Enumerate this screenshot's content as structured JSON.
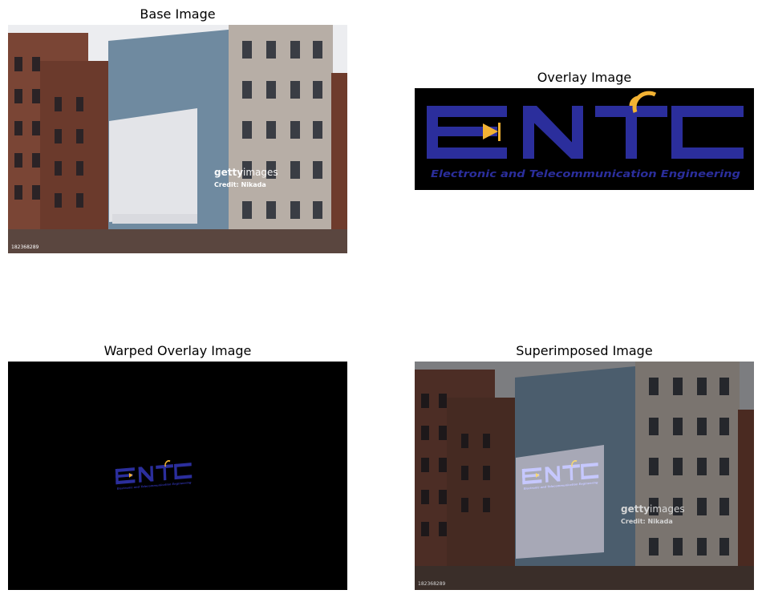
{
  "figure": {
    "panels": [
      {
        "title": "Base Image"
      },
      {
        "title": "Overlay Image"
      },
      {
        "title": "Warped Overlay Image"
      },
      {
        "title": "Superimposed Image"
      }
    ]
  },
  "logo": {
    "text": "ENTC",
    "subtitle": "Electronic and Telecommunication Engineering",
    "colors": {
      "blue": "#2b2e9c",
      "yellow": "#f2b233",
      "background": "#000000"
    }
  },
  "photo": {
    "watermark_brand": "getty",
    "watermark_suffix": "images",
    "credit": "Credit: Nikada",
    "image_id": "182368289"
  },
  "colors": {
    "sky": "#ecedf0",
    "brick": "#7a4535",
    "concrete": "#6f8aa0",
    "stone": "#b7aea6",
    "billboard": "#e3e4e8"
  }
}
